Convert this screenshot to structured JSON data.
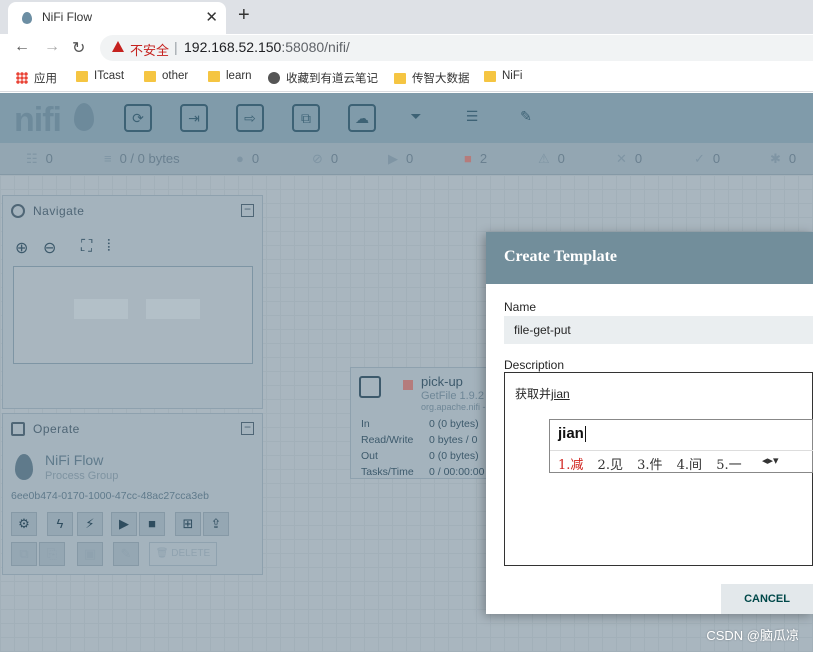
{
  "browser": {
    "tab_title": "NiFi Flow",
    "tab_close": "✕",
    "new_tab": "+",
    "security_label": "不安全",
    "url_host": "192.168.52.150",
    "url_rest": ":58080/nifi/",
    "bookmarks": [
      "应用",
      "ITcast",
      "other",
      "learn",
      "收藏到有道云笔记",
      "传智大数据",
      "NiFi"
    ]
  },
  "nifi": {
    "logo": "nifi",
    "status": {
      "threads": "0",
      "queued": "0 / 0 bytes",
      "transmitting": "0",
      "not_transmitting": "0",
      "running": "0",
      "stopped": "2",
      "invalid": "0",
      "disabled": "0",
      "up_to_date": "0",
      "locally_modified": "0"
    },
    "navigate": {
      "title": "Navigate"
    },
    "operate": {
      "title": "Operate",
      "name": "NiFi Flow",
      "type": "Process Group",
      "id": "6ee0b474-0170-1000-47cc-48ac27cca3eb",
      "delete_label": "DELETE"
    },
    "processor": {
      "name": "pick-up",
      "type": "GetFile 1.9.2",
      "package": "org.apache.nifi -",
      "rows": [
        {
          "label": "In",
          "value": "0 (0 bytes)"
        },
        {
          "label": "Read/Write",
          "value": "0 bytes / 0"
        },
        {
          "label": "Out",
          "value": "0 (0 bytes)"
        },
        {
          "label": "Tasks/Time",
          "value": "0 / 00:00:00"
        }
      ]
    }
  },
  "dialog": {
    "title": "Create Template",
    "name_label": "Name",
    "name_value": "file-get-put",
    "description_label": "Description",
    "description_text": "获取并",
    "description_composing": "jian",
    "cancel_label": "CANCEL"
  },
  "ime": {
    "composition": "jian",
    "candidates": [
      "1.减",
      "2.见",
      "3.件",
      "4.间",
      "5.一"
    ]
  },
  "watermark": "CSDN @脑瓜凉"
}
